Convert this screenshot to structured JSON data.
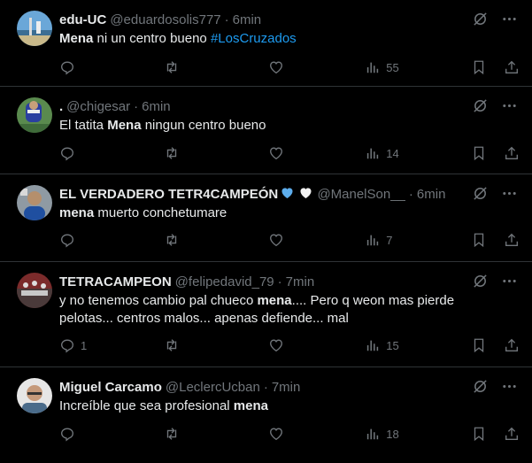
{
  "colors": {
    "background": "#000000",
    "text": "#e7e9ea",
    "muted": "#71767b",
    "link": "#1d9bf0",
    "divider": "#2f3336"
  },
  "icons": {
    "more": "more-dots-icon",
    "grok": "grok-slash-icon",
    "reply": "reply-icon",
    "retweet": "retweet-icon",
    "like": "heart-icon",
    "views": "views-bars-icon",
    "bookmark": "bookmark-icon",
    "share": "share-icon"
  },
  "tweets": [
    {
      "name": "edu-UC",
      "handle": "@eduardosolis777",
      "dot": "·",
      "time": "6min",
      "text_parts": [
        {
          "t": "Mena",
          "bold": true
        },
        {
          "t": " ni un centro bueno "
        },
        {
          "t": "#LosCruzados",
          "link": true
        }
      ],
      "replies": "",
      "retweets": "",
      "likes": "",
      "views": "55"
    },
    {
      "name": ".",
      "handle": "@chigesar",
      "dot": "·",
      "time": "6min",
      "text_parts": [
        {
          "t": "El tatita "
        },
        {
          "t": "Mena",
          "bold": true
        },
        {
          "t": " ningun centro bueno"
        }
      ],
      "replies": "",
      "retweets": "",
      "likes": "",
      "views": "14"
    },
    {
      "name": "EL VERDADERO TETR4CAMPEÓN",
      "name_emoji": "💙🤍",
      "handle": "@ManelSon__",
      "dot": "·",
      "time": "6min",
      "text_parts": [
        {
          "t": "mena",
          "bold": true
        },
        {
          "t": " muerto conchetumare"
        }
      ],
      "replies": "",
      "retweets": "",
      "likes": "",
      "views": "7"
    },
    {
      "name": "TETRACAMPEON",
      "handle": "@felipedavid_79",
      "dot": "·",
      "time": "7min",
      "text_parts": [
        {
          "t": "y no tenemos cambio pal chueco "
        },
        {
          "t": "mena",
          "bold": true
        },
        {
          "t": ".... Pero q weon mas pierde pelotas... centros malos... apenas defiende... mal"
        }
      ],
      "replies": "1",
      "retweets": "",
      "likes": "",
      "views": "15"
    },
    {
      "name": "Miguel Carcamo",
      "handle": "@LeclercUcban",
      "dot": "·",
      "time": "7min",
      "text_parts": [
        {
          "t": "Increíble que sea profesional "
        },
        {
          "t": "mena",
          "bold": true
        }
      ],
      "replies": "",
      "retweets": "",
      "likes": "",
      "views": "18"
    }
  ]
}
